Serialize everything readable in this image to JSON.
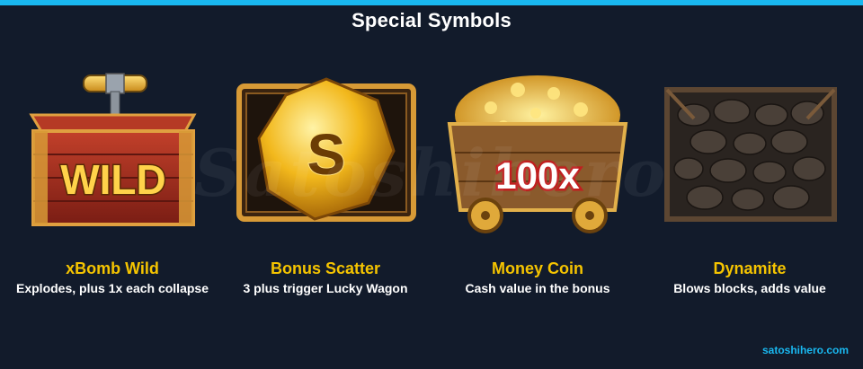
{
  "header": {
    "title": "Special Symbols"
  },
  "watermark_text": "Satoshihero",
  "symbols": [
    {
      "name": "xBomb Wild",
      "description": "Explodes, plus 1x each collapse",
      "badge": "WILD",
      "icon": "wild-crate-icon"
    },
    {
      "name": "Bonus Scatter",
      "description": "3 plus trigger Lucky Wagon",
      "badge": "S",
      "icon": "gold-nugget-scatter-icon"
    },
    {
      "name": "Money Coin",
      "description": "Cash value in the bonus",
      "badge": "100x",
      "icon": "gold-mine-cart-icon"
    },
    {
      "name": "Dynamite",
      "description": "Blows blocks, adds value",
      "icon": "rock-block-icon"
    }
  ],
  "footer": {
    "site": "satoshihero.com"
  },
  "colors": {
    "accent": "#19b8f0",
    "name_gold": "#f5c400",
    "background": "#121b2b"
  }
}
